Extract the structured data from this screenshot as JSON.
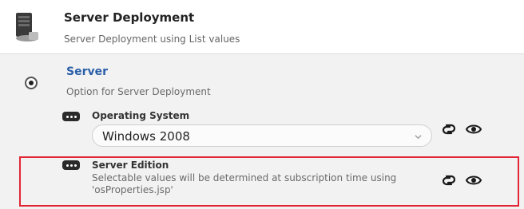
{
  "header": {
    "title": "Server Deployment",
    "subtitle": "Server Deployment using List values",
    "icon": "server-icon"
  },
  "option": {
    "title": "Server",
    "subtitle": "Option for  Server  Deployment",
    "selected": true
  },
  "fields": {
    "os": {
      "label": "Operating System",
      "value": "Windows 2008",
      "icon": "list-values-icon"
    },
    "edition": {
      "label": "Server Edition",
      "note": "Selectable values will be determined at subscription time using 'osProperties.jsp'",
      "icon": "list-values-icon"
    }
  },
  "actions": {
    "link_icon": "link-icon",
    "view_icon": "eye-icon"
  },
  "colors": {
    "accent": "#2a5fa8",
    "highlight_border": "#e32636"
  }
}
